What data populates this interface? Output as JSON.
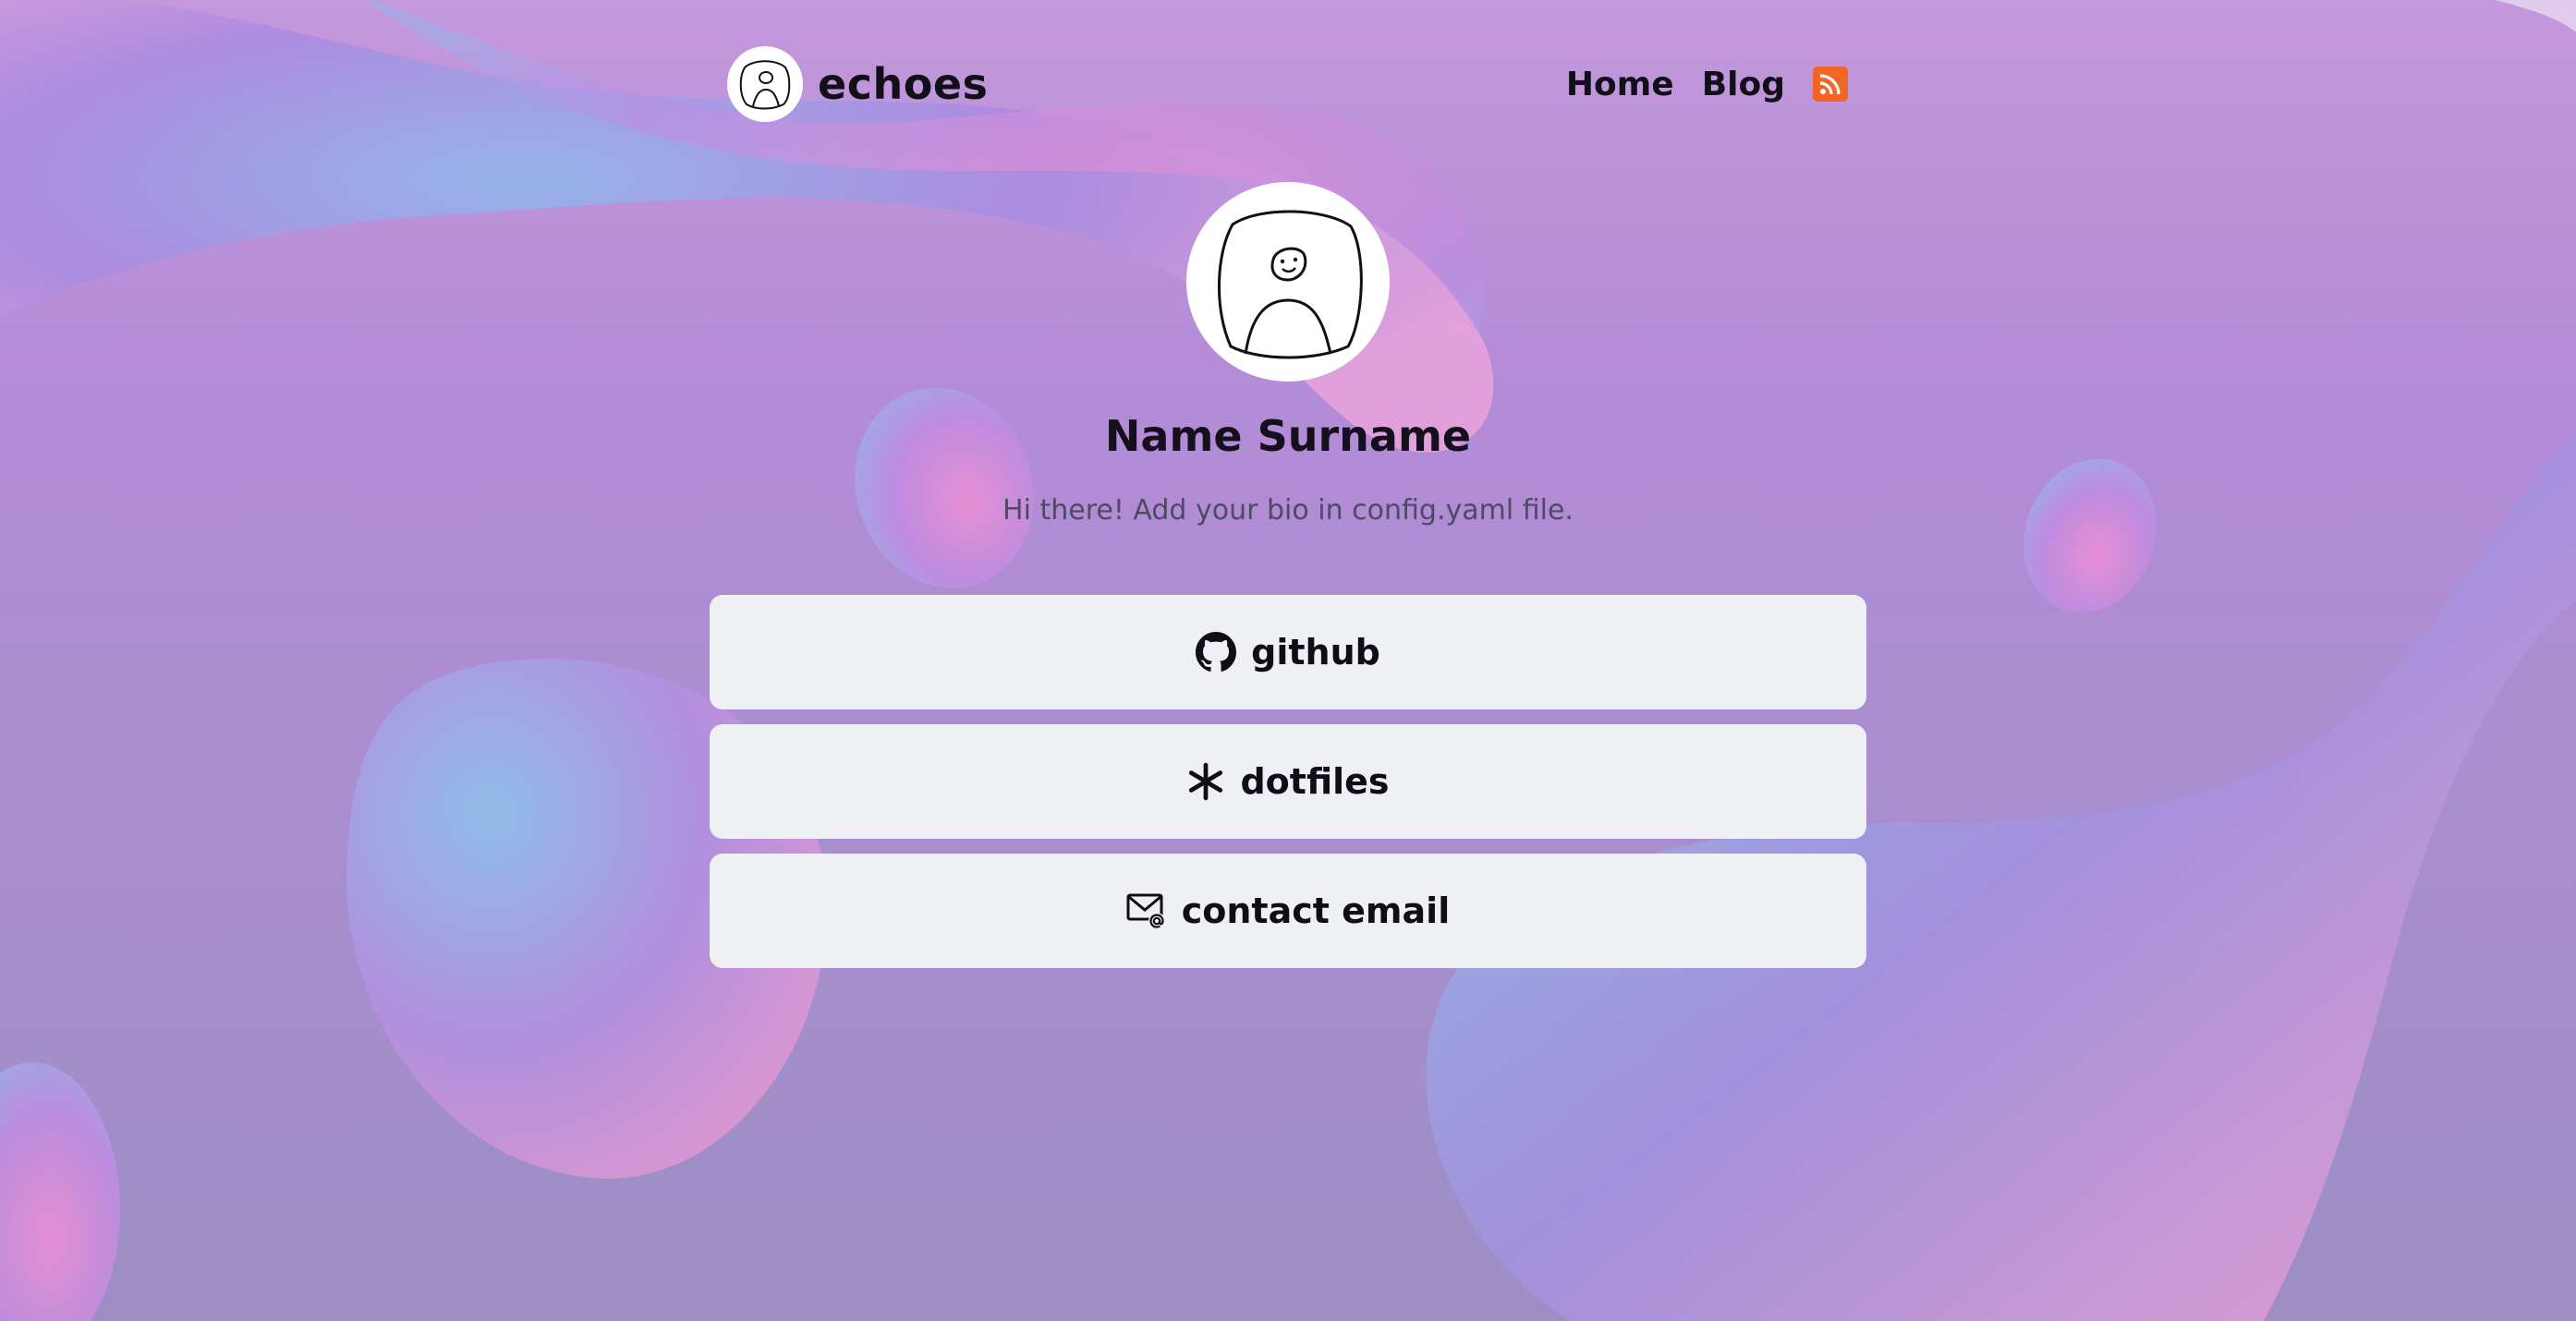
{
  "header": {
    "site_name": "echoes",
    "nav": [
      {
        "label": "Home"
      },
      {
        "label": "Blog"
      }
    ],
    "rss_icon": "rss-icon"
  },
  "profile": {
    "name": "Name Surname",
    "bio": "Hi there! Add your bio in config.yaml file."
  },
  "links": [
    {
      "label": "github",
      "icon": "github-icon"
    },
    {
      "label": "dotfiles",
      "icon": "asterisk-icon"
    },
    {
      "label": "contact email",
      "icon": "email-icon"
    }
  ],
  "colors": {
    "rss": "#f26522",
    "button_bg": "#eff0f4",
    "text": "#111018",
    "bio_text": "#4d4a63"
  }
}
